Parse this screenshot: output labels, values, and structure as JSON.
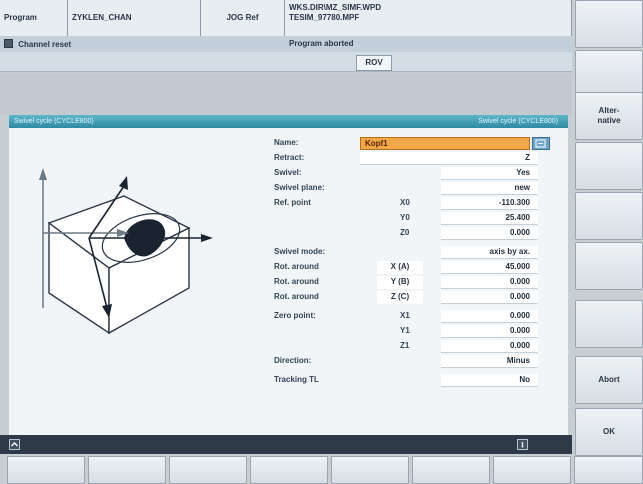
{
  "header": {
    "program_label": "Program",
    "channel_name": "ZYKLEN_CHAN",
    "mode": "JOG Ref",
    "path_line1": "WKS.DIR\\MZ_SIMF.WPD",
    "path_line2": "TESIM_97780.MPF",
    "channel_reset": "Channel reset",
    "program_status": "Program aborted",
    "rov": "ROV"
  },
  "dialog": {
    "title_left": "Swivel cycle (CYCLE800)",
    "title_right": "Swivel cycle (CYCLE800)",
    "fields": {
      "name_label": "Name:",
      "name_value": "Kopf1",
      "retract_label": "Retract:",
      "retract_value": "Z",
      "swivel_label": "Swivel:",
      "swivel_value": "Yes",
      "swivel_plane_label": "Swivel plane:",
      "swivel_plane_value": "new",
      "ref_point_label": "Ref. point",
      "x0_label": "X0",
      "x0_value": "-110.300",
      "y0_label": "Y0",
      "y0_value": "25.400",
      "z0_label": "Z0",
      "z0_value": "0.000",
      "swivel_mode_label": "Swivel mode:",
      "swivel_mode_value": "axis by ax.",
      "rot1_label": "Rot. around",
      "rot1_axis": "X (A)",
      "rot1_value": "45.000",
      "rot2_label": "Rot. around",
      "rot2_axis": "Y (B)",
      "rot2_value": "0.000",
      "rot3_label": "Rot. around",
      "rot3_axis": "Z (C)",
      "rot3_value": "0.000",
      "zero_point_label": "Zero point:",
      "x1_label": "X1",
      "x1_value": "0.000",
      "y1_label": "Y1",
      "y1_value": "0.000",
      "z1_label": "Z1",
      "z1_value": "0.000",
      "direction_label": "Direction:",
      "direction_value": "Minus",
      "tracking_label": "Tracking TL",
      "tracking_value": "No"
    }
  },
  "softkeys": {
    "alternative": "Alter-\nnative",
    "abort": "Abort",
    "ok": "OK"
  },
  "icons": {
    "channel_reset": "reset-icon",
    "status_left": "up-arrow-icon",
    "status_right": "info-icon",
    "dropdown": "dropdown-icon"
  },
  "colors": {
    "titlebar": "#2d8aa3",
    "active_field": "#f0a84a",
    "statusbar": "#2e3a47"
  }
}
